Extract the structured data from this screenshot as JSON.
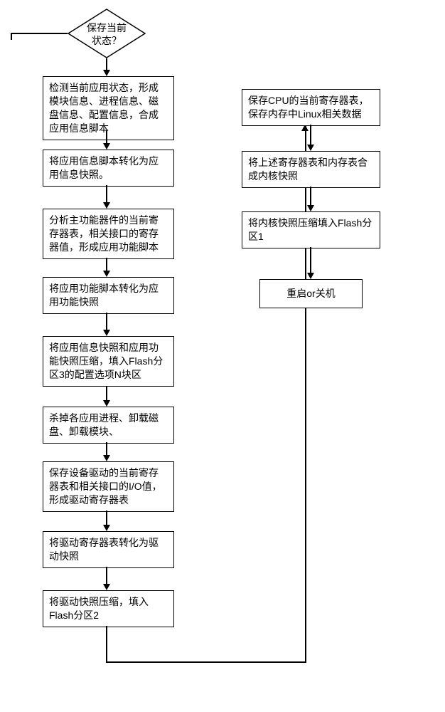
{
  "chart_data": {
    "type": "flowchart",
    "title": "",
    "decision": {
      "id": "d1",
      "label": "保存当前\n状态？"
    },
    "left_steps": [
      {
        "id": "s1",
        "text": "检测当前应用状态，形成模块信息、进程信息、磁盘信息、配置信息，合成应用信息脚本"
      },
      {
        "id": "s2",
        "text": "将应用信息脚本转化为应用信息快照。"
      },
      {
        "id": "s3",
        "text": "分析主功能器件的当前寄存器表，相关接口的寄存器值，形成应用功能脚本"
      },
      {
        "id": "s4",
        "text": "将应用功能脚本转化为应用功能快照"
      },
      {
        "id": "s5",
        "text": "将应用信息快照和应用功能快照压缩，填入Flash分区3的配置选项N块区"
      },
      {
        "id": "s6",
        "text": "杀掉各应用进程、卸载磁盘、卸载模块、"
      },
      {
        "id": "s7",
        "text": "保存设备驱动的当前寄存器表和相关接口的I/O值，形成驱动寄存器表"
      },
      {
        "id": "s8",
        "text": "将驱动寄存器表转化为驱动快照"
      },
      {
        "id": "s9",
        "text": "将驱动快照压缩，填入Flash分区2"
      }
    ],
    "right_steps": [
      {
        "id": "r1",
        "text": "保存CPU的当前寄存器表，保存内存中Linux相关数据"
      },
      {
        "id": "r2",
        "text": "将上述寄存器表和内存表合成内核快照"
      },
      {
        "id": "r3",
        "text": "将内核快照压缩填入Flash分区1"
      },
      {
        "id": "r4",
        "text": "重启or关机"
      }
    ],
    "edges": [
      {
        "from": "d1",
        "to": "s1",
        "label": ""
      },
      {
        "from": "d1",
        "to": "exit-left",
        "label": ""
      },
      {
        "from": "s1",
        "to": "s2"
      },
      {
        "from": "s2",
        "to": "s3"
      },
      {
        "from": "s3",
        "to": "s4"
      },
      {
        "from": "s4",
        "to": "s5"
      },
      {
        "from": "s5",
        "to": "s6"
      },
      {
        "from": "s6",
        "to": "s7"
      },
      {
        "from": "s7",
        "to": "s8"
      },
      {
        "from": "s8",
        "to": "s9"
      },
      {
        "from": "s9",
        "to": "r1",
        "route": "down-right-up"
      },
      {
        "from": "r1",
        "to": "r2"
      },
      {
        "from": "r2",
        "to": "r3"
      },
      {
        "from": "r3",
        "to": "r4"
      }
    ]
  }
}
